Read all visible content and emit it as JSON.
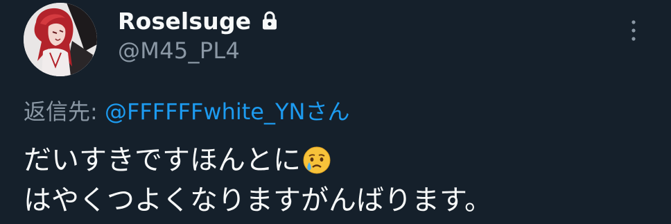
{
  "author": {
    "display_name": "Roselsuge",
    "handle": "@M45_PL4",
    "avatar_icon": "profile-avatar-anime-red-hair",
    "protected_icon": "lock-icon"
  },
  "reply": {
    "prefix": "返信先: ",
    "to_user": "@FFFFFFwhite_YNさん"
  },
  "tweet": {
    "line1": "だいすきですほんとに",
    "emoji": "crying-face-emoji",
    "line2": "はやくつよくなりますがんばります。"
  },
  "menu": {
    "icon": "more-vertical-icon"
  },
  "colors": {
    "background": "#15202b",
    "text": "#f7f9f9",
    "muted": "#8b98a5",
    "link": "#1d9bf0"
  }
}
